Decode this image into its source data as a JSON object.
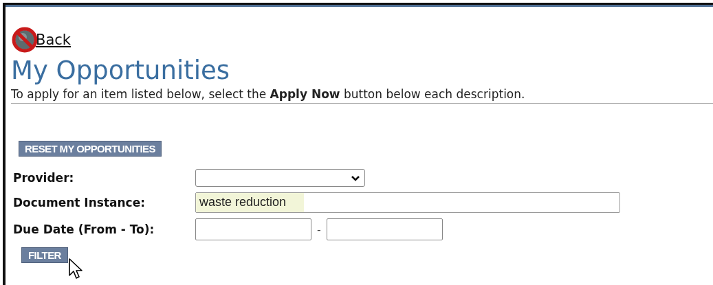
{
  "back_link": {
    "label": "Back"
  },
  "title": "My Opportunities",
  "instruction": "To apply for an item listed below, select the **Apply Now** button below each description.",
  "reset_button": {
    "label": "RESET MY OPPORTUNITIES"
  },
  "fields": [
    {
      "kind": "select",
      "label": "Provider:"
    },
    {
      "kind": "text",
      "label": "Document Instance:",
      "value": "waste reduction",
      "highlighted": true
    },
    {
      "kind": "date_range",
      "label": "Due Date (From - To):",
      "separator": "-"
    }
  ],
  "filter_button": {
    "label": "FILTER"
  }
}
